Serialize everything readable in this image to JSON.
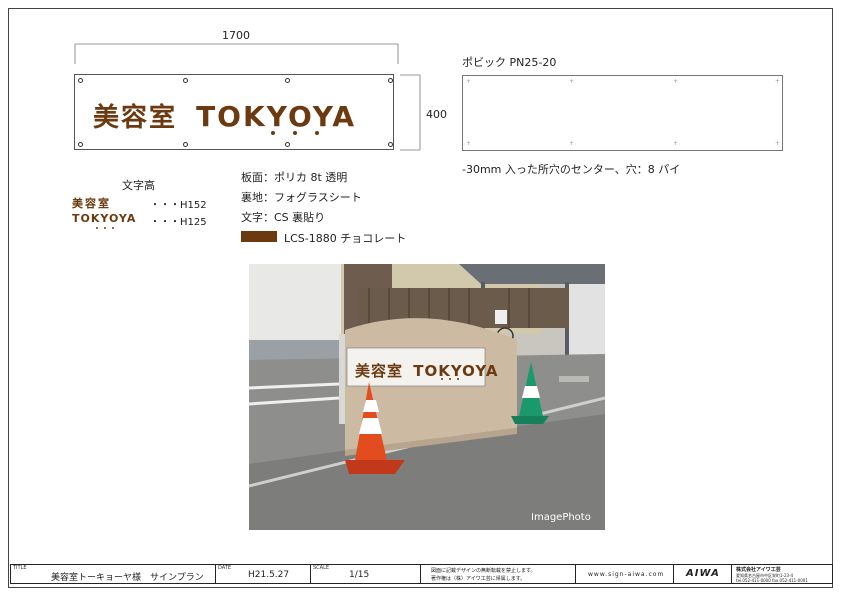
{
  "dimensions": {
    "width_label": "1700",
    "height_label": "400"
  },
  "sign": {
    "name_jp": "美容室",
    "name_en": "TOKYOYA"
  },
  "plate": {
    "label": "ポビック PN25-20",
    "note": "-30mm 入った所穴のセンター、穴：8 パイ"
  },
  "text_heights": {
    "heading": "文字高",
    "rows": [
      {
        "sample": "美容室",
        "value": "・・・H152"
      },
      {
        "sample": "TOKYOYA",
        "value": "・・・H125"
      }
    ]
  },
  "specs": [
    {
      "label": "板面：ポリカ 8t 透明"
    },
    {
      "label": "裏地：フォグラスシート"
    },
    {
      "label": "文字：CS 裏貼り"
    }
  ],
  "swatch": {
    "color": "#6b3a10",
    "label": "LCS-1880 チョコレート"
  },
  "photo": {
    "caption": "ImagePhoto",
    "sign_jp": "美容室",
    "sign_en": "TOKYOYA"
  },
  "title_block": {
    "title_caption": "TITLE",
    "title": "美容室トーキョーヤ様　サインプラン",
    "date_caption": "DATE",
    "date": "H21.5.27",
    "scale_caption": "SCALE",
    "scale": "1/15",
    "notice_line1": "図面に記載デザインの無断転載を禁止します。",
    "notice_line2": "著作権は（株）アイワ工芸に帰属します。",
    "website": "www.sign-aiwa.com",
    "logo": "AIWA",
    "company": "株式会社アイワ工芸",
    "company_address": "愛知県名古屋市中区栄町1-23-4",
    "company_tel": "tel.052-411-0000  fax.052-411-0001"
  }
}
